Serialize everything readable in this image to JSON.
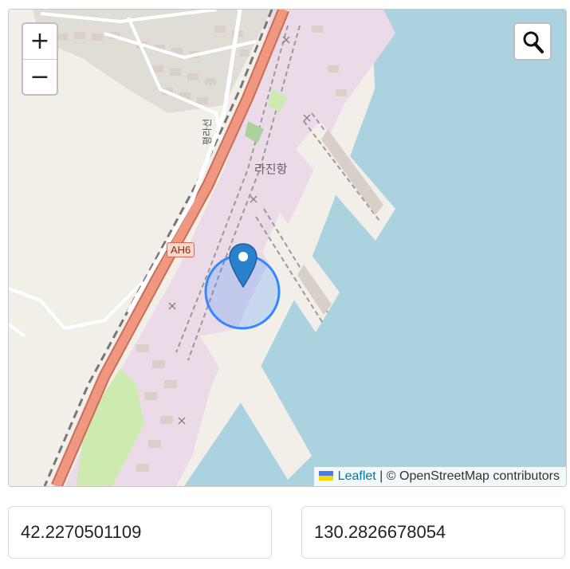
{
  "map": {
    "zoom_in_label": "+",
    "zoom_out_label": "−",
    "search_icon": "magnifier-icon",
    "labels": {
      "port_name": "라진항",
      "road_label": "평라선",
      "highway_shield": "AH6"
    },
    "attribution": {
      "flag_icon": "ukraine-flag-icon",
      "leaflet_link": "Leaflet",
      "separator": " | ",
      "osm_text": "© OpenStreetMap contributors"
    },
    "colors": {
      "water": "#aad3df",
      "land": "#f2efe9",
      "industrial": "#ebdbe8",
      "highway": "#f0977f",
      "marker": "#2a81cb",
      "accuracy_circle": "#3388ff"
    }
  },
  "coordinates": {
    "latitude": "42.2270501109",
    "longitude": "130.2826678054"
  }
}
